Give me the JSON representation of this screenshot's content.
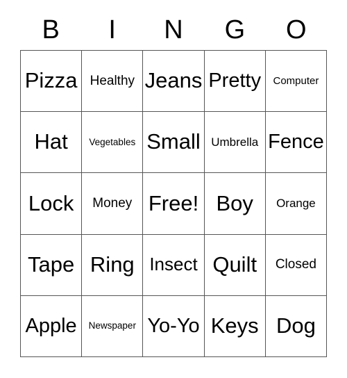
{
  "card": {
    "header": {
      "letters": [
        "B",
        "I",
        "N",
        "G",
        "O"
      ]
    },
    "grid": {
      "rows": [
        {
          "cells": [
            {
              "text": "Pizza",
              "size": "fs-xl"
            },
            {
              "text": "Healthy",
              "size": "fs-sm"
            },
            {
              "text": "Jeans",
              "size": "fs-xl"
            },
            {
              "text": "Pretty",
              "size": "fs-lg"
            },
            {
              "text": "Computer",
              "size": "fs-xxs"
            }
          ]
        },
        {
          "cells": [
            {
              "text": "Hat",
              "size": "fs-xl"
            },
            {
              "text": "Vegetables",
              "size": "fs-tiny"
            },
            {
              "text": "Small",
              "size": "fs-xl"
            },
            {
              "text": "Umbrella",
              "size": "fs-xs"
            },
            {
              "text": "Fence",
              "size": "fs-lg"
            }
          ]
        },
        {
          "cells": [
            {
              "text": "Lock",
              "size": "fs-xl"
            },
            {
              "text": "Money",
              "size": "fs-sm"
            },
            {
              "text": "Free!",
              "size": "fs-xl"
            },
            {
              "text": "Boy",
              "size": "fs-xl"
            },
            {
              "text": "Orange",
              "size": "fs-xs"
            }
          ]
        },
        {
          "cells": [
            {
              "text": "Tape",
              "size": "fs-xl"
            },
            {
              "text": "Ring",
              "size": "fs-xl"
            },
            {
              "text": "Insect",
              "size": "fs-md"
            },
            {
              "text": "Quilt",
              "size": "fs-xl"
            },
            {
              "text": "Closed",
              "size": "fs-sm"
            }
          ]
        },
        {
          "cells": [
            {
              "text": "Apple",
              "size": "fs-lg"
            },
            {
              "text": "Newspaper",
              "size": "fs-tiny"
            },
            {
              "text": "Yo-Yo",
              "size": "fs-lg"
            },
            {
              "text": "Keys",
              "size": "fs-xl"
            },
            {
              "text": "Dog",
              "size": "fs-xl"
            }
          ]
        }
      ]
    },
    "colors": {
      "background": "#ffffff",
      "text": "#000000",
      "border": "#555555"
    }
  }
}
